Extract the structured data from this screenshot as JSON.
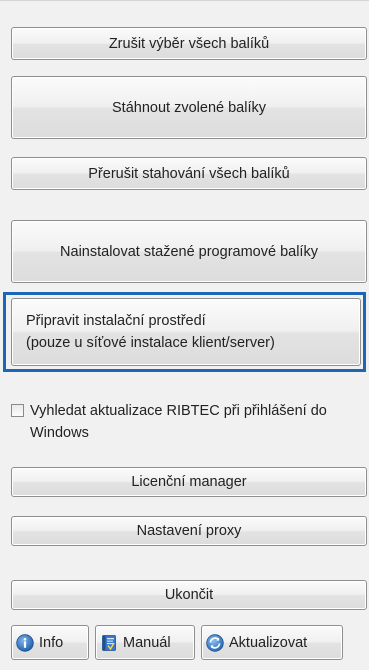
{
  "buttons": {
    "deselect_all": "Zrušit výběr všech balíků",
    "download_selected": "Stáhnout zvolené balíky",
    "cancel_all_downloads": "Přerušit stahování všech balíků",
    "install_downloaded": "Nainstalovat stažené programové balíky",
    "prepare_env_line1": "Připravit instalační prostředí",
    "prepare_env_line2": "(pouze u síťové instalace klient/server)",
    "license_manager": "Licenční manager",
    "proxy_settings": "Nastavení proxy",
    "quit": "Ukončit"
  },
  "checkbox": {
    "label": "Vyhledat aktualizace RIBTEC při přihlášení do Windows",
    "checked": false
  },
  "footer": {
    "info": {
      "label": "Info",
      "icon": "info-icon"
    },
    "manual": {
      "label": "Manuál",
      "icon": "manual-book-icon"
    },
    "update": {
      "label": "Aktualizovat",
      "icon": "update-globe-icon"
    }
  },
  "colors": {
    "focus_border": "#1b66b5",
    "panel_bg": "#f1f1f1",
    "button_border": "#8f8f8f"
  }
}
